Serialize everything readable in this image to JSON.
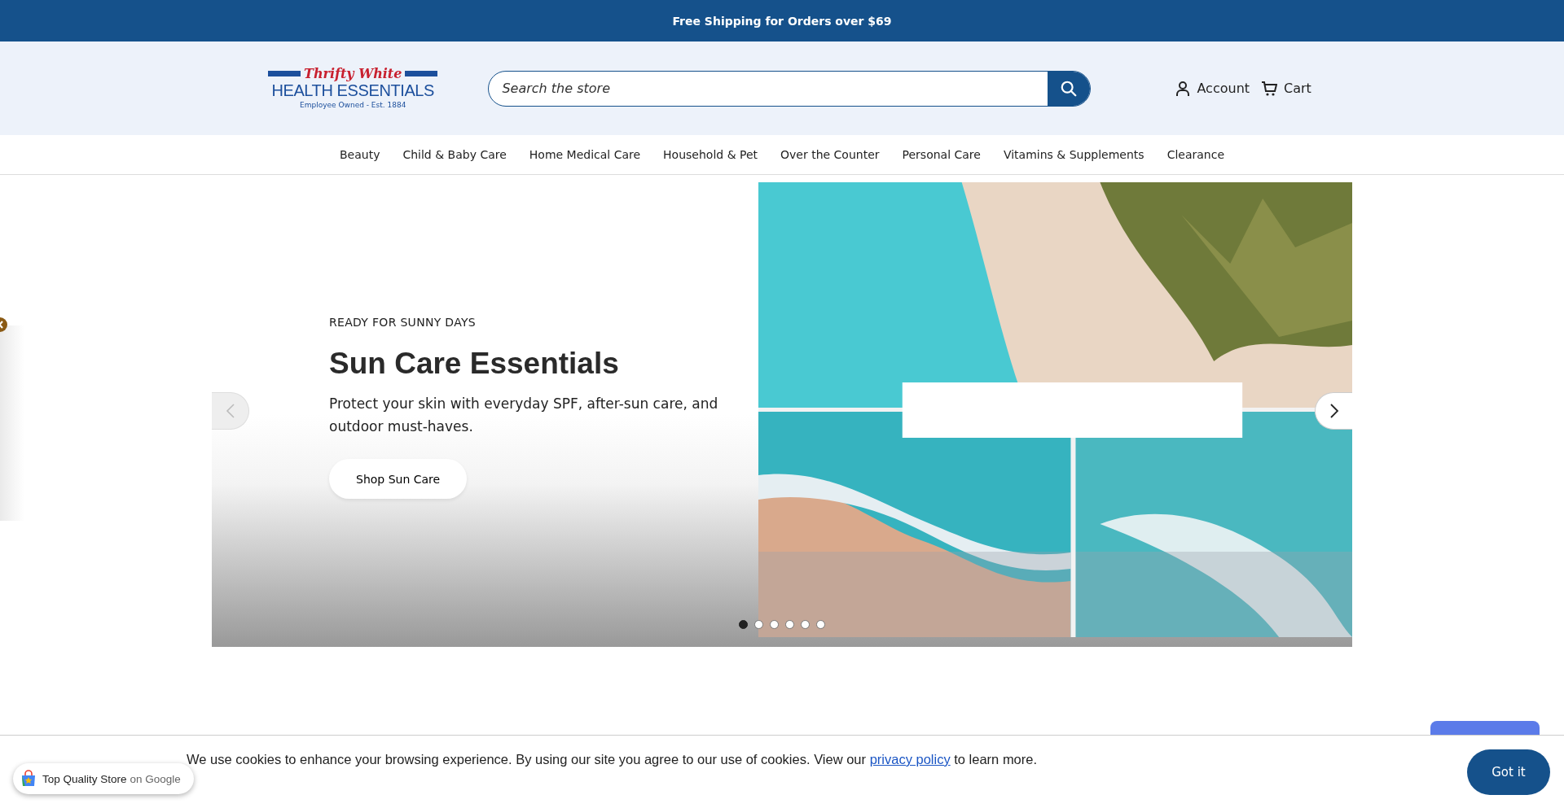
{
  "announcement": "Free Shipping for Orders over $69",
  "header": {
    "logo": {
      "script": "Thrifty White",
      "name": "HEALTH ESSENTIALS",
      "tagline": "Employee Owned - Est. 1884"
    },
    "search": {
      "placeholder": "Search the store"
    },
    "account": "Account",
    "cart": "Cart"
  },
  "nav": [
    "Beauty",
    "Child & Baby Care",
    "Home Medical Care",
    "Household & Pet",
    "Over the Counter",
    "Personal Care",
    "Vitamins & Supplements",
    "Clearance"
  ],
  "hero": {
    "eyebrow": "READY FOR SUNNY DAYS",
    "title": "Sun Care Essentials",
    "text": "Protect your skin with everyday SPF, after-sun care, and outdoor must-haves.",
    "button": "Shop Sun Care",
    "dots": [
      {
        "selected": true
      },
      {
        "selected": false
      },
      {
        "selected": false
      },
      {
        "selected": false
      },
      {
        "selected": false
      },
      {
        "selected": false
      }
    ]
  },
  "cookie": {
    "text_before": "We use cookies to enhance your browsing experience. By using our site you agree to our use of cookies. View our",
    "link": "privacy policy",
    "text_after": "to learn more.",
    "button": "Got it"
  },
  "badge": {
    "label": "Top Quality Store",
    "suffix": "on Google"
  }
}
